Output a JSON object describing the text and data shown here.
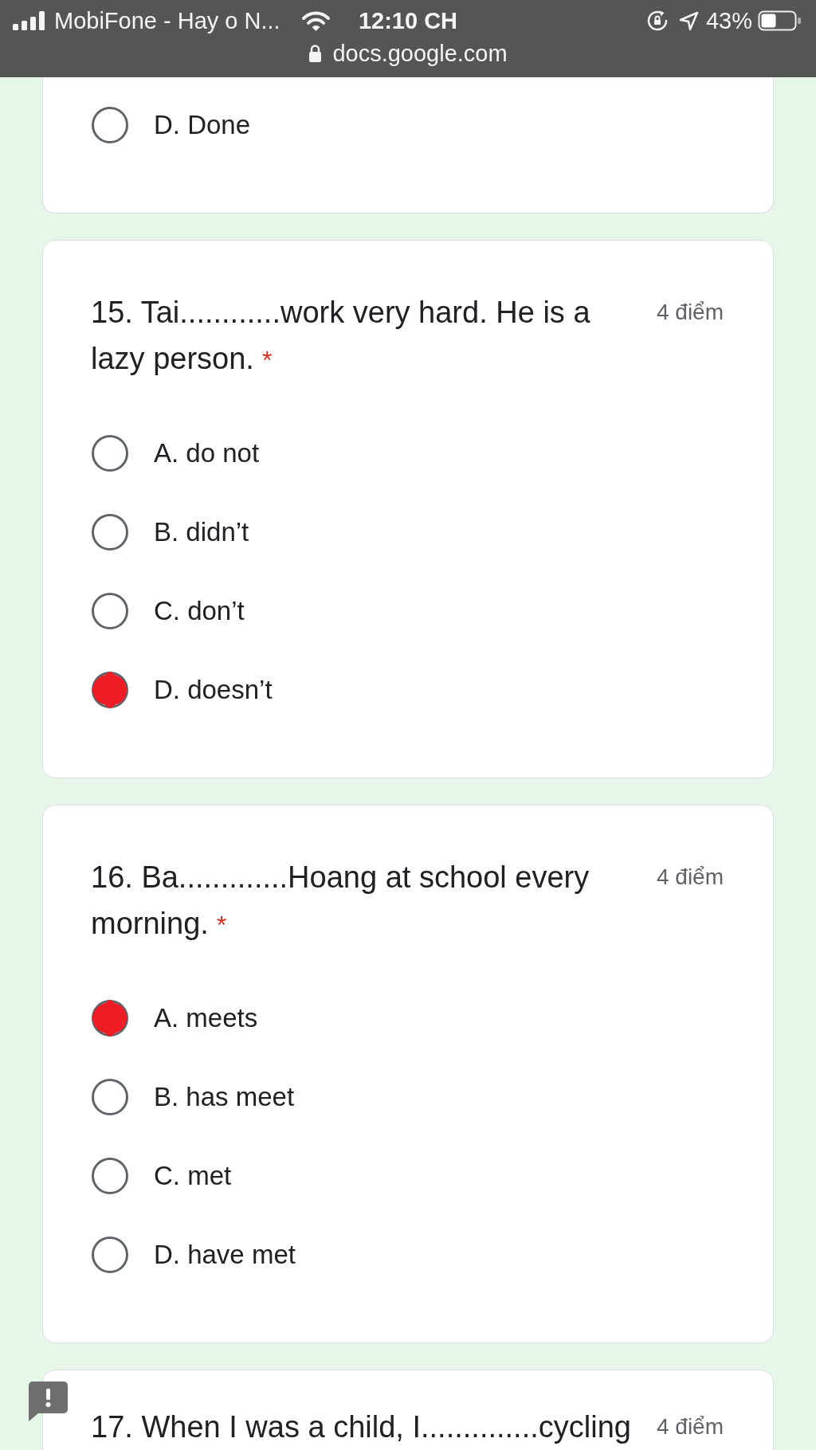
{
  "status_bar": {
    "carrier": "MobiFone - Hay o N...",
    "time": "12:10 CH",
    "battery": "43%"
  },
  "address_bar": {
    "url": "docs.google.com"
  },
  "questions": [
    {
      "options": [
        {
          "label": "D. Done",
          "selected": false
        }
      ]
    },
    {
      "title": "15. Tai............work very hard. He is a lazy person.",
      "required_mark": "*",
      "points": "4 điểm",
      "options": [
        {
          "label": "A. do not",
          "selected": false
        },
        {
          "label": "B. didn’t",
          "selected": false
        },
        {
          "label": "C. don’t",
          "selected": false
        },
        {
          "label": "D. doesn’t",
          "selected": true
        }
      ]
    },
    {
      "title": "16. Ba.............Hoang at school every morning.",
      "required_mark": "*",
      "points": "4 điểm",
      "options": [
        {
          "label": "A. meets",
          "selected": true
        },
        {
          "label": "B. has meet",
          "selected": false
        },
        {
          "label": "C. met",
          "selected": false
        },
        {
          "label": "D. have met",
          "selected": false
        }
      ]
    },
    {
      "title": "17. When I was a child, I..............cycling",
      "points": "4 điểm"
    }
  ]
}
